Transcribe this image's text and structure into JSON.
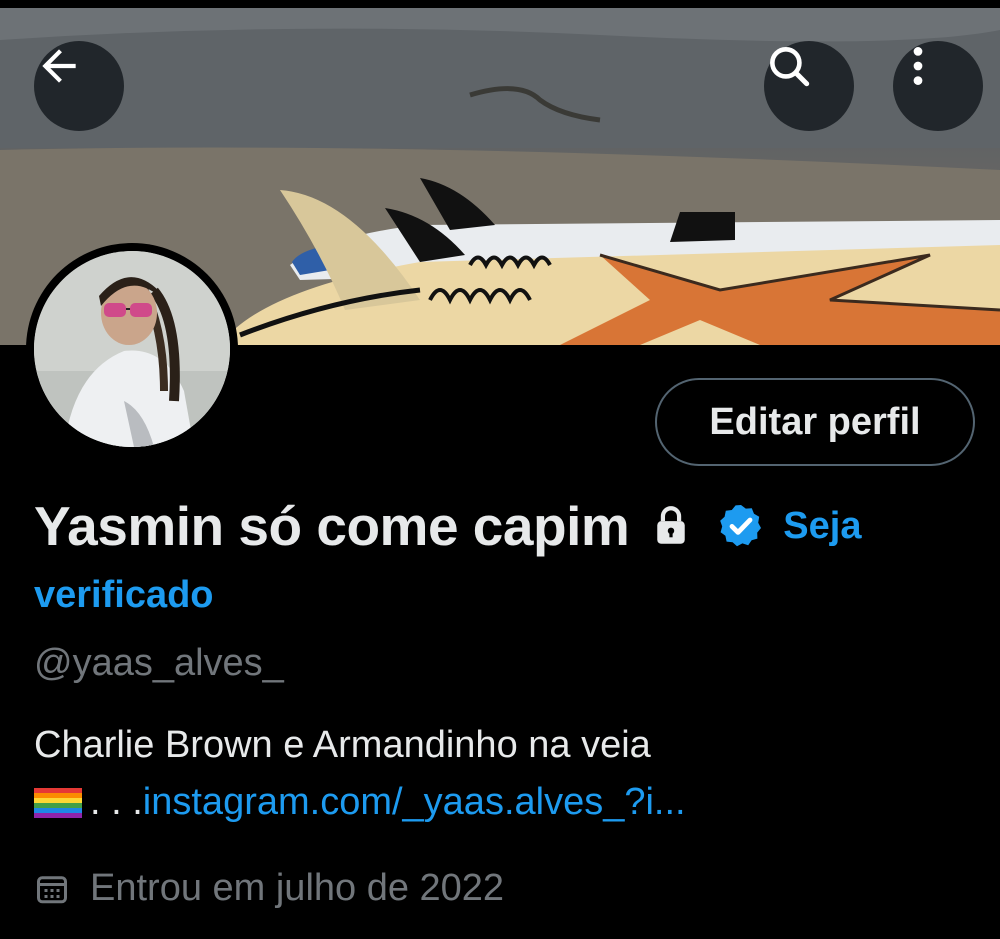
{
  "header": {
    "back_icon": "arrow-left-icon",
    "search_icon": "search-icon",
    "more_icon": "more-vertical-icon"
  },
  "profile": {
    "edit_button": "Editar perfil",
    "display_name": "Yasmin só come capim",
    "verify_prompt_part1": "Seja",
    "verify_prompt_part2": "verificado",
    "handle": "@yaas_alves_",
    "bio_line1": "Charlie Brown e Armandinho na veia",
    "bio_prefix": ". . .",
    "bio_link": "instagram.com/_yaas.alves_?i...",
    "joined": "Entrou em julho de 2022"
  },
  "colors": {
    "background": "#000000",
    "text_primary": "#e7e9ea",
    "text_secondary": "#71767b",
    "accent": "#1d9bf0",
    "border": "#536471"
  }
}
